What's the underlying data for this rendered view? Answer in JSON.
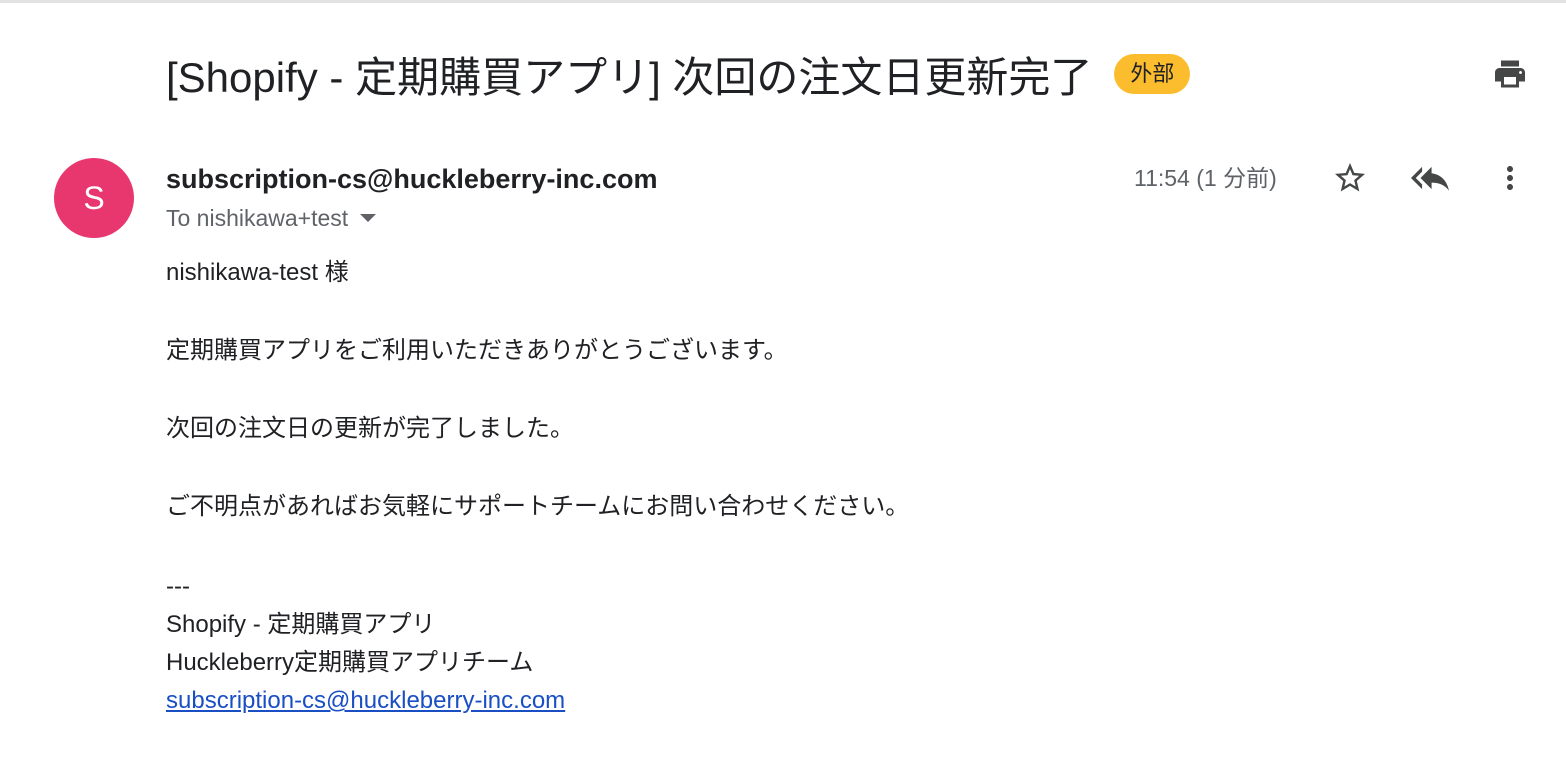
{
  "email": {
    "subject": "[Shopify - 定期購買アプリ] 次回の注文日更新完了",
    "label_badge": "外部",
    "sender": {
      "avatar_initial": "S",
      "avatar_color": "#e8366f",
      "address": "subscription-cs@huckleberry-inc.com"
    },
    "recipient_line": "To nishikawa+test",
    "timestamp": "11:54 (1 分前)",
    "toolbar_icons": [
      "print-icon",
      "star-icon",
      "reply-all-icon",
      "more-vert-icon"
    ],
    "body": {
      "greeting": "nishikawa-test 様",
      "line1": "定期購買アプリをご利用いただきありがとうございます。",
      "line2": "次回の注文日の更新が完了しました。",
      "line3": "ご不明点があればお気軽にサポートチームにお問い合わせください。",
      "separator": "---",
      "signature": {
        "line1": "Shopify - 定期購買アプリ",
        "line2": "Huckleberry定期購買アプリチーム",
        "email_link": "subscription-cs@huckleberry-inc.com"
      }
    }
  },
  "colors": {
    "badge": "#fbbc2e",
    "link": "#1a4fc4",
    "muted_text": "#5f6368"
  }
}
